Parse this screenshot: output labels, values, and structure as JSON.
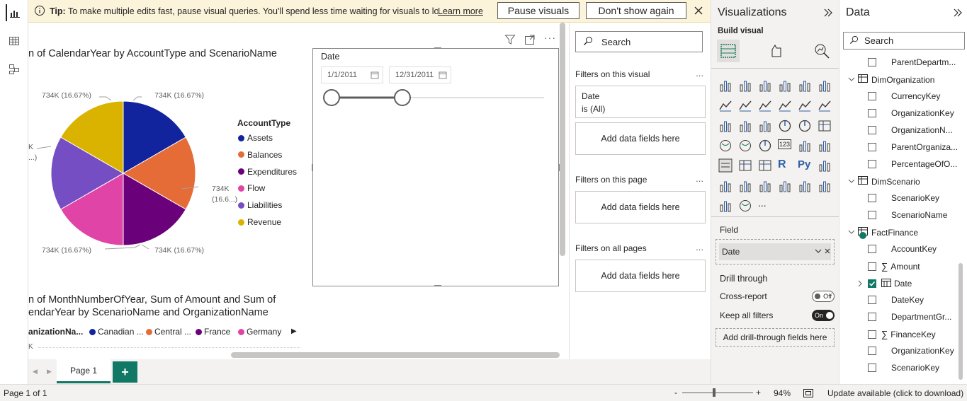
{
  "tipbar": {
    "tip_label": "Tip:",
    "tip_text": "To make multiple edits fast, pause visual queries. You'll spend less time waiting for visuals to loa...",
    "learn_more": "Learn more",
    "pause_button": "Pause visuals",
    "dont_show_button": "Don't show again"
  },
  "canvas": {
    "pie_title": "n of CalendarYear by AccountType and ScenarioName",
    "pie_labels": [
      "734K (16.67%)",
      "734K (16.67%)",
      "734K",
      "(16.6...)",
      "734K (16.67%)",
      "734K (16.67%)",
      "K",
      "...)"
    ],
    "legend_title": "AccountType",
    "legend": [
      {
        "label": "Assets",
        "color": "#12239e"
      },
      {
        "label": "Balances",
        "color": "#e66c37"
      },
      {
        "label": "Expenditures",
        "color": "#6b007b"
      },
      {
        "label": "Flow",
        "color": "#e044a7"
      },
      {
        "label": "Liabilities",
        "color": "#744ec2"
      },
      {
        "label": "Revenue",
        "color": "#d9b300"
      }
    ],
    "pie_values": [
      16.67,
      16.67,
      16.67,
      16.67,
      16.67,
      16.67
    ],
    "chart2_title_line1": "n of MonthNumberOfYear, Sum of Amount and Sum of",
    "chart2_title_line2": "endarYear by ScenarioName and OrganizationName",
    "chart2_legend_title": "anizationNa...",
    "chart2_legend": [
      {
        "label": "Canadian ...",
        "color": "#12239e"
      },
      {
        "label": "Central ...",
        "color": "#e66c37"
      },
      {
        "label": "France",
        "color": "#6b007b"
      },
      {
        "label": "Germany",
        "color": "#e044a7"
      }
    ],
    "chart2_axis": "K",
    "slicer_title": "Date",
    "slicer_start": "1/1/2011",
    "slicer_end": "12/31/2011"
  },
  "filters": {
    "search_placeholder": "Search",
    "on_visual": "Filters on this visual",
    "date_card_title": "Date",
    "date_card_value": "is (All)",
    "add_fields": "Add data fields here",
    "on_page": "Filters on this page",
    "on_all": "Filters on all pages",
    "more": "..."
  },
  "viz": {
    "title": "Visualizations",
    "build_visual": "Build visual",
    "more_visuals": "...",
    "field_label": "Field",
    "field_value": "Date",
    "drill_through": "Drill through",
    "cross_report": "Cross-report",
    "cross_report_state": "Off",
    "keep_filters": "Keep all filters",
    "keep_filters_state": "On",
    "add_drill": "Add drill-through fields here",
    "r_icon": "R",
    "py_icon": "Py",
    "num_icon": "123"
  },
  "data": {
    "title": "Data",
    "search_placeholder": "Search",
    "rows": [
      {
        "label": "ParentDepartm...",
        "type": "field",
        "checked": false
      },
      {
        "label": "DimOrganization",
        "type": "table"
      },
      {
        "label": "CurrencyKey",
        "type": "field",
        "checked": false
      },
      {
        "label": "OrganizationKey",
        "type": "field",
        "checked": false
      },
      {
        "label": "OrganizationN...",
        "type": "field",
        "checked": false
      },
      {
        "label": "ParentOrganiza...",
        "type": "field",
        "checked": false
      },
      {
        "label": "PercentageOfO...",
        "type": "field",
        "checked": false
      },
      {
        "label": "DimScenario",
        "type": "table"
      },
      {
        "label": "ScenarioKey",
        "type": "field",
        "checked": false
      },
      {
        "label": "ScenarioName",
        "type": "field",
        "checked": false
      },
      {
        "label": "FactFinance",
        "type": "table"
      },
      {
        "label": "AccountKey",
        "type": "field",
        "checked": false
      },
      {
        "label": "Amount",
        "type": "sum",
        "checked": false
      },
      {
        "label": "Date",
        "type": "date",
        "checked": true
      },
      {
        "label": "DateKey",
        "type": "field",
        "checked": false
      },
      {
        "label": "DepartmentGr...",
        "type": "field",
        "checked": false
      },
      {
        "label": "FinanceKey",
        "type": "sum",
        "checked": false
      },
      {
        "label": "OrganizationKey",
        "type": "field",
        "checked": false
      },
      {
        "label": "ScenarioKey",
        "type": "field",
        "checked": false
      }
    ]
  },
  "pages": {
    "tab": "Page 1",
    "add": "+"
  },
  "status": {
    "page_count": "Page 1 of 1",
    "zoom": "94%",
    "minus": "-",
    "plus": "+",
    "update": "Update available (click to download)"
  }
}
